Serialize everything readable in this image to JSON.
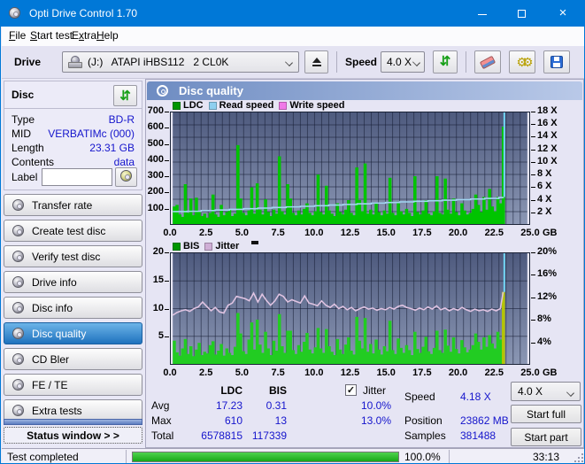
{
  "window": {
    "title": "Opti Drive Control 1.70",
    "close_glyph": "×"
  },
  "menu": {
    "items": [
      {
        "pre": "",
        "key": "F",
        "post": "ile"
      },
      {
        "pre": "",
        "key": "S",
        "post": "tart test"
      },
      {
        "pre": "E",
        "key": "x",
        "post": "tra"
      },
      {
        "pre": "",
        "key": "H",
        "post": "elp"
      }
    ]
  },
  "toolbar": {
    "drive_label": "Drive",
    "drive_value": "(J:)   ATAPI iHBS112   2 CL0K",
    "speed_label": "Speed",
    "speed_value": "4.0 X",
    "icons": [
      "drive-icon",
      "eject-icon",
      "refresh-icon",
      "eraser-icon",
      "gears-icon",
      "save-icon"
    ]
  },
  "sidebar": {
    "disc_header": "Disc",
    "info": [
      {
        "label": "Type",
        "value": "BD-R"
      },
      {
        "label": "MID",
        "value": "VERBATIMc (000)"
      },
      {
        "label": "Length",
        "value": "23.31 GB"
      },
      {
        "label": "Contents",
        "value": "data"
      }
    ],
    "label_field": {
      "label": "Label",
      "value": ""
    },
    "nav": [
      {
        "label": "Transfer rate",
        "selected": false
      },
      {
        "label": "Create test disc",
        "selected": false
      },
      {
        "label": "Verify test disc",
        "selected": false
      },
      {
        "label": "Drive info",
        "selected": false
      },
      {
        "label": "Disc info",
        "selected": false
      },
      {
        "label": "Disc quality",
        "selected": true
      },
      {
        "label": "CD Bler",
        "selected": false
      },
      {
        "label": "FE / TE",
        "selected": false
      },
      {
        "label": "Extra tests",
        "selected": false
      }
    ],
    "status_window_label": "Status window > >"
  },
  "panel": {
    "title": "Disc quality"
  },
  "chart_data": [
    {
      "type": "bar",
      "title": "LDC with read speed overlay",
      "legend": [
        {
          "label": "LDC",
          "color": "#009600"
        },
        {
          "label": "Read speed",
          "color": "#8fd0f0"
        },
        {
          "label": "Write speed",
          "color": "#f07ae8"
        }
      ],
      "extra_dash": false,
      "xlim": [
        0,
        25
      ],
      "x_ticks": [
        0,
        2.5,
        5,
        7.5,
        10,
        12.5,
        15,
        17.5,
        20,
        22.5,
        25
      ],
      "x_tick_labels": [
        "0.0",
        "2.5",
        "5.0",
        "7.5",
        "10.0",
        "12.5",
        "15.0",
        "17.5",
        "20.0",
        "22.5",
        "25.0"
      ],
      "x_unit": "GB",
      "ylim_left": [
        0,
        700
      ],
      "y_ticks_left": [
        100,
        200,
        300,
        400,
        500,
        600,
        700
      ],
      "y_ticks_right": [
        {
          "v": 2,
          "label": "2 X"
        },
        {
          "v": 4,
          "label": "4 X"
        },
        {
          "v": 6,
          "label": "6 X"
        },
        {
          "v": 8,
          "label": "8 X"
        },
        {
          "v": 10,
          "label": "10 X"
        },
        {
          "v": 12,
          "label": "12 X"
        },
        {
          "v": 14,
          "label": "14 X"
        },
        {
          "v": 16,
          "label": "16 X"
        },
        {
          "v": 18,
          "label": "18 X"
        }
      ],
      "ylim_right": [
        0,
        18
      ],
      "grid_h_values": [
        77.8,
        155.6,
        233.3,
        311.1,
        388.9,
        466.7,
        544.4,
        622.2
      ],
      "grid_v_step_gb": 0.5,
      "bars": {
        "name": "LDC",
        "color": "#00c400",
        "start_gb": 0,
        "step_gb": 0.195,
        "values": [
          110,
          120,
          60,
          45,
          250,
          70,
          160,
          55,
          165,
          80,
          50,
          65,
          40,
          70,
          185,
          60,
          45,
          120,
          55,
          75,
          90,
          50,
          65,
          495,
          160,
          70,
          55,
          85,
          230,
          65,
          255,
          90,
          60,
          155,
          75,
          50,
          90,
          65,
          425,
          80,
          60,
          250,
          160,
          70,
          55,
          85,
          60,
          95,
          130,
          70,
          55,
          80,
          310,
          75,
          60,
          240,
          85,
          65,
          50,
          130,
          75,
          60,
          90,
          150,
          70,
          55,
          355,
          150,
          80,
          380,
          65,
          90,
          60,
          130,
          75,
          55,
          85,
          65,
          290,
          70,
          55,
          140,
          80,
          60,
          95,
          70,
          50,
          300,
          75,
          60,
          85,
          150,
          65,
          55,
          80,
          300,
          70,
          60,
          285,
          90,
          65,
          160,
          75,
          55,
          130,
          85,
          60,
          70,
          95,
          185,
          120,
          75,
          170,
          90,
          220,
          110,
          80,
          170,
          130,
          610
        ]
      },
      "line": {
        "name": "Read speed",
        "color": "#a2d6f2",
        "stepped": true,
        "points": [
          [
            0,
            78
          ],
          [
            1,
            80
          ],
          [
            2,
            84
          ],
          [
            3,
            88
          ],
          [
            4,
            92
          ],
          [
            5,
            96
          ],
          [
            6,
            100
          ],
          [
            7,
            104
          ],
          [
            8,
            108
          ],
          [
            9,
            111
          ],
          [
            10,
            115
          ],
          [
            11,
            119
          ],
          [
            12,
            123
          ],
          [
            13,
            127
          ],
          [
            14,
            131
          ],
          [
            15,
            135
          ],
          [
            16,
            139
          ],
          [
            17,
            143
          ],
          [
            18,
            146
          ],
          [
            19,
            150
          ],
          [
            20,
            153
          ],
          [
            21,
            157
          ],
          [
            22,
            161
          ],
          [
            23,
            166
          ],
          [
            23.3,
            170
          ]
        ]
      },
      "end_spike": {
        "x_gb": 23.38,
        "from": 170,
        "to": 700,
        "color": "#72d6f6"
      }
    },
    {
      "type": "bar",
      "title": "BIS with jitter overlay",
      "legend": [
        {
          "label": "BIS",
          "color": "#009600"
        },
        {
          "label": "Jitter",
          "color": "#cfaed6"
        }
      ],
      "extra_dash": true,
      "xlim": [
        0,
        25
      ],
      "x_ticks": [
        0,
        2.5,
        5,
        7.5,
        10,
        12.5,
        15,
        17.5,
        20,
        22.5,
        25
      ],
      "x_tick_labels": [
        "0.0",
        "2.5",
        "5.0",
        "7.5",
        "10.0",
        "12.5",
        "15.0",
        "17.5",
        "20.0",
        "22.5",
        "25.0"
      ],
      "x_unit": "GB",
      "ylim_left": [
        0,
        20
      ],
      "y_ticks_left": [
        5,
        10,
        15,
        20
      ],
      "y_ticks_right": [
        {
          "v": 4,
          "label": "4%"
        },
        {
          "v": 8,
          "label": "8%"
        },
        {
          "v": 12,
          "label": "12%"
        },
        {
          "v": 16,
          "label": "16%"
        },
        {
          "v": 20,
          "label": "20%"
        }
      ],
      "ylim_right": [
        0,
        20
      ],
      "grid_h_values": [
        5,
        10,
        15
      ],
      "grid_v_step_gb": 0.5,
      "bars": {
        "name": "BIS",
        "color": "#22cc22",
        "start_gb": 0,
        "step_gb": 0.195,
        "last_color": "#b4c400",
        "values": [
          4.2,
          2.1,
          1.5,
          2.8,
          4.5,
          1.8,
          3.2,
          1.4,
          2.6,
          3.8,
          1.6,
          2.2,
          1.9,
          3.4,
          4.1,
          1.7,
          2.4,
          3.6,
          1.5,
          2.8,
          2.0,
          1.6,
          3.1,
          9.2,
          5.5,
          2.3,
          1.8,
          4.4,
          7.5,
          2.6,
          8.0,
          3.5,
          2.0,
          5.8,
          2.8,
          1.6,
          4.2,
          2.4,
          9.0,
          3.2,
          2.0,
          6.0,
          6.0,
          2.5,
          1.8,
          3.4,
          2.2,
          4.0,
          5.6,
          2.6,
          1.9,
          3.0,
          6.5,
          2.8,
          2.0,
          6.3,
          3.2,
          2.2,
          1.6,
          4.5,
          2.6,
          1.8,
          3.5,
          4.8,
          2.4,
          1.7,
          8.5,
          4.2,
          2.8,
          8.3,
          2.2,
          3.6,
          1.9,
          4.4,
          2.6,
          1.7,
          3.2,
          2.3,
          7.8,
          2.5,
          1.8,
          4.6,
          2.9,
          2.0,
          3.4,
          2.5,
          1.6,
          5.8,
          2.7,
          2.0,
          3.1,
          4.9,
          2.3,
          1.8,
          2.9,
          6.0,
          2.5,
          2.0,
          6.2,
          3.3,
          2.2,
          4.8,
          2.7,
          1.9,
          4.3,
          3.0,
          2.1,
          2.6,
          3.4,
          5.5,
          4.0,
          2.6,
          4.8,
          3.1,
          5.2,
          3.7,
          2.8,
          5.8,
          4.4,
          13
        ]
      },
      "line": {
        "name": "Jitter",
        "color": "#e0c4e2",
        "stepped": false,
        "points": [
          [
            0,
            8.8
          ],
          [
            0.3,
            9.3
          ],
          [
            0.6,
            9.6
          ],
          [
            0.9,
            9.8
          ],
          [
            1.2,
            9.5
          ],
          [
            1.5,
            10.0
          ],
          [
            1.8,
            10.3
          ],
          [
            2.1,
            11.2
          ],
          [
            2.4,
            10.4
          ],
          [
            2.7,
            9.6
          ],
          [
            3.0,
            10.2
          ],
          [
            3.3,
            9.4
          ],
          [
            3.6,
            9.2
          ],
          [
            3.9,
            10.6
          ],
          [
            4.2,
            11.0
          ],
          [
            4.5,
            12.2
          ],
          [
            4.8,
            12.0
          ],
          [
            5.1,
            11.8
          ],
          [
            5.4,
            11.4
          ],
          [
            5.7,
            12.8
          ],
          [
            6.0,
            11.2
          ],
          [
            6.3,
            12.6
          ],
          [
            6.6,
            11.5
          ],
          [
            6.9,
            10.6
          ],
          [
            7.2,
            11.4
          ],
          [
            7.5,
            12.6
          ],
          [
            7.8,
            12.2
          ],
          [
            8.1,
            11.2
          ],
          [
            8.4,
            11.6
          ],
          [
            8.7,
            11.3
          ],
          [
            9.0,
            11.0
          ],
          [
            9.3,
            12.3
          ],
          [
            9.6,
            11.0
          ],
          [
            9.9,
            10.8
          ],
          [
            10.2,
            10.5
          ],
          [
            10.5,
            11.4
          ],
          [
            10.8,
            10.6
          ],
          [
            11.1,
            10.2
          ],
          [
            11.4,
            10.8
          ],
          [
            11.7,
            10.0
          ],
          [
            12.0,
            10.4
          ],
          [
            12.3,
            9.8
          ],
          [
            12.6,
            10.2
          ],
          [
            12.9,
            9.6
          ],
          [
            13.2,
            10.0
          ],
          [
            13.5,
            10.3
          ],
          [
            13.8,
            9.9
          ],
          [
            14.1,
            10.1
          ],
          [
            14.4,
            9.7
          ],
          [
            14.7,
            10.0
          ],
          [
            15.0,
            9.8
          ],
          [
            15.3,
            10.2
          ],
          [
            15.6,
            9.9
          ],
          [
            15.9,
            10.4
          ],
          [
            16.2,
            10.6
          ],
          [
            16.5,
            10.2
          ],
          [
            16.8,
            10.0
          ],
          [
            17.1,
            9.7
          ],
          [
            17.4,
            10.1
          ],
          [
            17.7,
            9.8
          ],
          [
            18.0,
            10.3
          ],
          [
            18.3,
            9.9
          ],
          [
            18.6,
            10.5
          ],
          [
            18.9,
            9.8
          ],
          [
            19.2,
            10.1
          ],
          [
            19.5,
            9.6
          ],
          [
            19.8,
            10.0
          ],
          [
            20.1,
            9.7
          ],
          [
            20.4,
            10.2
          ],
          [
            20.7,
            9.8
          ],
          [
            21.0,
            9.5
          ],
          [
            21.3,
            9.9
          ],
          [
            21.6,
            9.6
          ],
          [
            21.9,
            9.8
          ],
          [
            22.2,
            9.5
          ],
          [
            22.5,
            9.9
          ],
          [
            22.8,
            9.6
          ],
          [
            23.1,
            10.0
          ],
          [
            23.3,
            13.0
          ]
        ]
      },
      "end_spike": {
        "x_gb": 23.38,
        "from": 13,
        "to": 20,
        "color": "#72d6f6"
      }
    }
  ],
  "stats": {
    "col_headers": {
      "ldc": "LDC",
      "bis": "BIS",
      "jitter": "Jitter"
    },
    "jitter_checked": true,
    "rows": [
      {
        "label": "Avg",
        "ldc": "17.23",
        "bis": "0.31",
        "jitter": "10.0%"
      },
      {
        "label": "Max",
        "ldc": "610",
        "bis": "13",
        "jitter": "13.0%"
      },
      {
        "label": "Total",
        "ldc": "6578815",
        "bis": "117339",
        "jitter": ""
      }
    ],
    "speed": {
      "label": "Speed",
      "value": "4.18 X"
    },
    "position": {
      "label": "Position",
      "value": "23862 MB"
    },
    "samples": {
      "label": "Samples",
      "value": "381488"
    },
    "speed_select": "4.0 X",
    "start_full": "Start full",
    "start_part": "Start part"
  },
  "statusbar": {
    "status": "Test completed",
    "progress_pct": 100,
    "progress_label": "100.0%",
    "time": "33:13"
  }
}
